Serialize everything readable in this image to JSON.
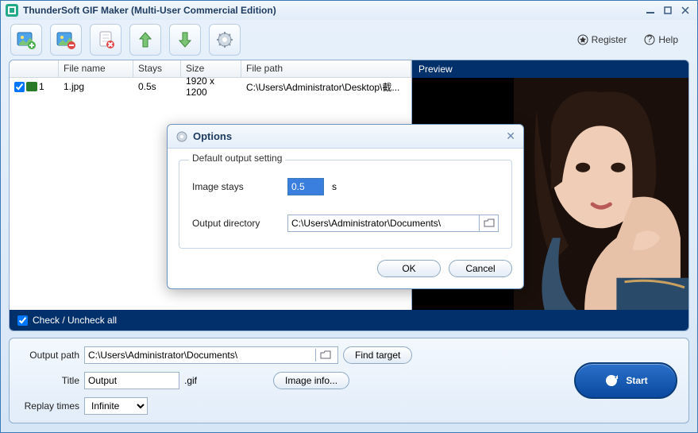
{
  "window": {
    "title": "ThunderSoft GIF Maker (Multi-User Commercial Edition)"
  },
  "toolbar": {
    "register": "Register",
    "help": "Help"
  },
  "list": {
    "headers": {
      "name": "File name",
      "stays": "Stays",
      "size": "Size",
      "path": "File path"
    },
    "rows": [
      {
        "idx": "1",
        "name": "1.jpg",
        "stays": "0.5s",
        "size": "1920 x 1200",
        "path": "C:\\Users\\Administrator\\Desktop\\截..."
      }
    ]
  },
  "preview": {
    "title": "Preview"
  },
  "checkbar": {
    "label": "Check / Uncheck all"
  },
  "bottom": {
    "output_path_label": "Output path",
    "output_path": "C:\\Users\\Administrator\\Documents\\",
    "find_target": "Find target",
    "title_label": "Title",
    "title_value": "Output",
    "title_ext": ".gif",
    "image_info": "Image info...",
    "replay_label": "Replay times",
    "replay_value": "Infinite",
    "start": "Start"
  },
  "dialog": {
    "title": "Options",
    "legend": "Default output setting",
    "image_stays_label": "Image stays",
    "image_stays_value": "0.5",
    "image_stays_unit": "s",
    "output_dir_label": "Output directory",
    "output_dir_value": "C:\\Users\\Administrator\\Documents\\",
    "ok": "OK",
    "cancel": "Cancel"
  }
}
